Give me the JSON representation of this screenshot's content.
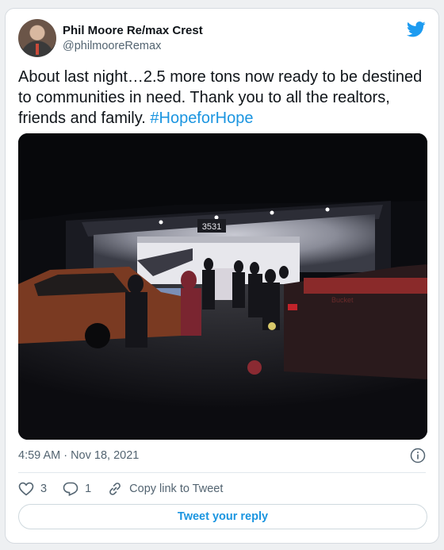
{
  "author": {
    "name": "Phil Moore Re/max Crest",
    "handle": "@philmooreRemax"
  },
  "tweet": {
    "text": "About last night…2.5 more tons now ready to be destined to communities in need. Thank you to all the realtors, friends and family. ",
    "hashtag": "#HopeforHope",
    "timestamp": "4:59 AM · Nov 18, 2021"
  },
  "photo": {
    "building_number": "3531",
    "truck_text": "Bucket"
  },
  "actions": {
    "likes": "3",
    "replies": "1",
    "copy_link_label": "Copy link to Tweet",
    "reply_button_label": "Tweet your reply"
  },
  "colors": {
    "accent": "#1b95e0",
    "text": "#0f1419",
    "muted": "#536471"
  },
  "icons": [
    "twitter-bird-icon",
    "info-icon",
    "heart-icon",
    "reply-icon",
    "link-icon"
  ]
}
